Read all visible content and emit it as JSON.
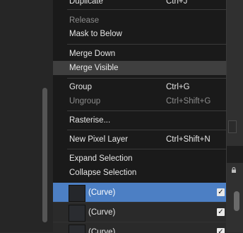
{
  "menu": {
    "duplicate": {
      "label": "Duplicate",
      "shortcut": "Ctrl+J"
    },
    "release": {
      "label": "Release"
    },
    "mask_to_below": {
      "label": "Mask to Below"
    },
    "merge_down": {
      "label": "Merge Down"
    },
    "merge_visible": {
      "label": "Merge Visible"
    },
    "group": {
      "label": "Group",
      "shortcut": "Ctrl+G"
    },
    "ungroup": {
      "label": "Ungroup",
      "shortcut": "Ctrl+Shift+G"
    },
    "rasterise": {
      "label": "Rasterise..."
    },
    "new_pixel_layer": {
      "label": "New Pixel Layer",
      "shortcut": "Ctrl+Shift+N"
    },
    "expand_selection": {
      "label": "Expand Selection"
    },
    "collapse_selection": {
      "label": "Collapse Selection"
    }
  },
  "layers": [
    {
      "name": "(Curve)",
      "selected": true,
      "visible_check": "✓"
    },
    {
      "name": "(Curve)",
      "selected": false,
      "visible_check": "✓"
    },
    {
      "name": "(Curve)",
      "selected": false,
      "visible_check": "✓"
    }
  ],
  "icons": {
    "lock": "lock-icon",
    "check": "checkmark-icon"
  },
  "colors": {
    "selection": "#4c7fc4",
    "menu_bg": "#1a1a1a",
    "highlight": "#3f3f3f"
  }
}
